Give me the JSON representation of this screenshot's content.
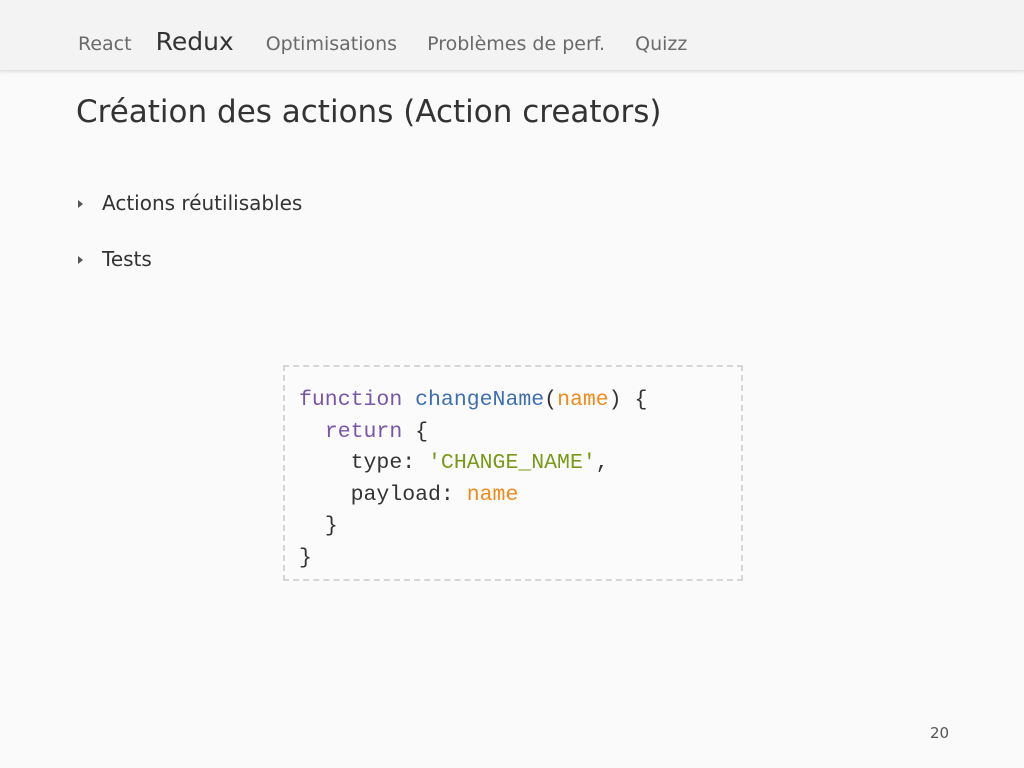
{
  "nav": {
    "items": [
      {
        "label": "React",
        "active": false
      },
      {
        "label": "Redux",
        "active": true
      },
      {
        "label": "Optimisations",
        "active": false
      },
      {
        "label": "Problèmes de perf.",
        "active": false
      },
      {
        "label": "Quizz",
        "active": false
      }
    ]
  },
  "slide": {
    "title": "Création des actions (Action creators)",
    "bullets": [
      "Actions réutilisables",
      "Tests"
    ],
    "page_number": "20"
  },
  "code": {
    "line1": {
      "kw": "function",
      "fn": "changeName",
      "open_paren": "(",
      "param": "name",
      "close": ") {"
    },
    "line2": {
      "kw": "return",
      "rest": " {"
    },
    "line3": {
      "key": "type: ",
      "str": "'CHANGE_NAME'",
      "rest": ","
    },
    "line4": {
      "key": "payload: ",
      "value": "name"
    },
    "line5": {
      "text": "}"
    },
    "line6": {
      "text": "}"
    }
  },
  "colors": {
    "keyword": "#7a55a8",
    "function_name": "#3e6fb0",
    "parameter": "#f28a1a",
    "string": "#7a9a17",
    "text": "#333333",
    "nav_inactive": "#6a6a6a"
  }
}
